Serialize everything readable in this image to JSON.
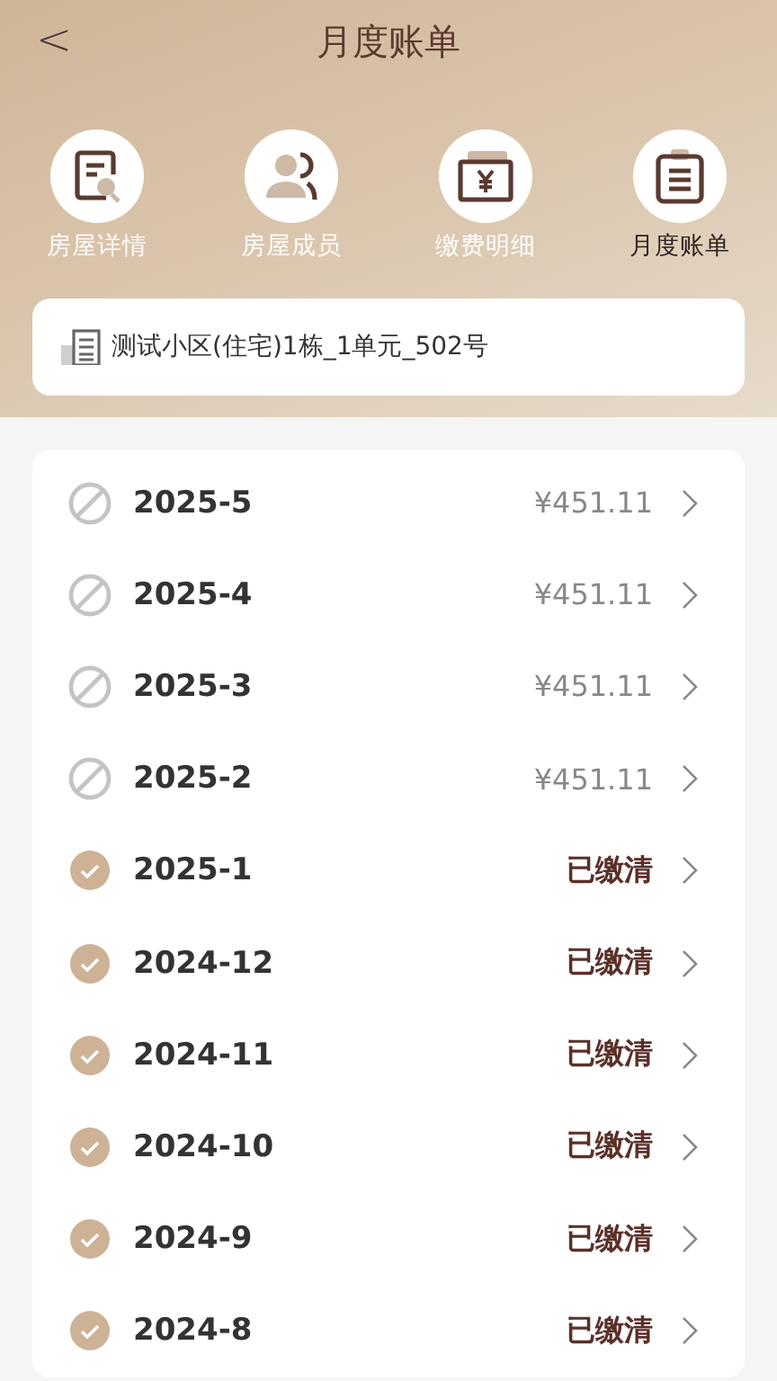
{
  "header": {
    "back": "<",
    "title": "月度账单"
  },
  "tabs": [
    {
      "kind": "detail",
      "label": "房屋详情",
      "selected": false
    },
    {
      "kind": "members",
      "label": "房屋成员",
      "selected": false
    },
    {
      "kind": "payment",
      "label": "缴费明细",
      "selected": false
    },
    {
      "kind": "bill",
      "label": "月度账单",
      "selected": true
    }
  ],
  "address": "测试小区(住宅)1栋_1单元_502号",
  "bills": [
    {
      "month": "2025-5",
      "paid": false,
      "status": "¥451.11"
    },
    {
      "month": "2025-4",
      "paid": false,
      "status": "¥451.11"
    },
    {
      "month": "2025-3",
      "paid": false,
      "status": "¥451.11"
    },
    {
      "month": "2025-2",
      "paid": false,
      "status": "¥451.11"
    },
    {
      "month": "2025-1",
      "paid": true,
      "status": "已缴清"
    },
    {
      "month": "2024-12",
      "paid": true,
      "status": "已缴清"
    },
    {
      "month": "2024-11",
      "paid": true,
      "status": "已缴清"
    },
    {
      "month": "2024-10",
      "paid": true,
      "status": "已缴清"
    },
    {
      "month": "2024-9",
      "paid": true,
      "status": "已缴清"
    },
    {
      "month": "2024-8",
      "paid": true,
      "status": "已缴清"
    }
  ]
}
